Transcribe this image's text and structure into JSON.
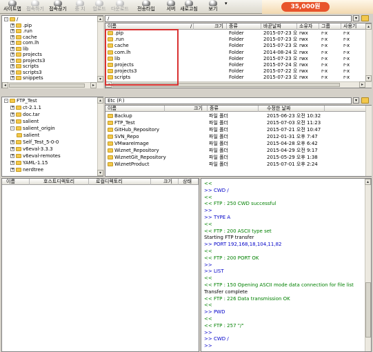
{
  "toolbar": {
    "items": [
      {
        "label": "사이트맵",
        "icon": "sitemap-icon",
        "disabled": false
      },
      {
        "label": "접속하기",
        "icon": "connect-icon",
        "disabled": true
      },
      {
        "label": "접속끊기",
        "icon": "disconnect-icon",
        "disabled": false
      },
      {
        "label": "중 지",
        "icon": "stop-icon",
        "disabled": true
      },
      {
        "label": "업로드",
        "icon": "upload-icon",
        "disabled": true
      },
      {
        "label": "다운로드",
        "icon": "download-icon",
        "disabled": true
      },
      {
        "label": "전송타입",
        "icon": "transfer-type-icon",
        "disabled": false
      },
      {
        "label": "서버",
        "icon": "server-icon",
        "disabled": false
      },
      {
        "label": "새로고침",
        "icon": "refresh-icon",
        "disabled": false
      },
      {
        "label": "보기",
        "icon": "view-icon",
        "disabled": false
      }
    ],
    "ad_price": "35,000원"
  },
  "remote": {
    "path": "/",
    "tree": [
      {
        "label": "/",
        "level": 0,
        "sign": "-"
      },
      {
        "label": ".pip",
        "level": 1,
        "sign": "+"
      },
      {
        "label": ".run",
        "level": 1,
        "sign": "+"
      },
      {
        "label": "cache",
        "level": 1,
        "sign": "+"
      },
      {
        "label": "com.lh",
        "level": 1,
        "sign": "+"
      },
      {
        "label": "lib",
        "level": 1,
        "sign": "+"
      },
      {
        "label": "projects",
        "level": 1,
        "sign": "+"
      },
      {
        "label": "projects3",
        "level": 1,
        "sign": "+"
      },
      {
        "label": "scripts",
        "level": 1,
        "sign": "+"
      },
      {
        "label": "scripts3",
        "level": 1,
        "sign": "+"
      },
      {
        "label": "snippets",
        "level": 1,
        "sign": "+"
      }
    ],
    "columns": [
      "이름",
      "/",
      "크기",
      "종류",
      "바꾼날짜",
      "소유자",
      "그룹",
      "사용기"
    ],
    "files": [
      {
        "name": ".pip",
        "type": "Folder",
        "date": "2015-07-23 오...",
        "owner": "rwx",
        "group": "r-x",
        "other": "r-x"
      },
      {
        "name": ".run",
        "type": "Folder",
        "date": "2015-07-23 오...",
        "owner": "rwx",
        "group": "r-x",
        "other": "r-x"
      },
      {
        "name": "cache",
        "type": "Folder",
        "date": "2015-07-23 오...",
        "owner": "rwx",
        "group": "r-x",
        "other": "r-x"
      },
      {
        "name": "com.lh",
        "type": "Folder",
        "date": "2014-08-24 오...",
        "owner": "rwx",
        "group": "r-x",
        "other": "r-x"
      },
      {
        "name": "lib",
        "type": "Folder",
        "date": "2015-07-23 오...",
        "owner": "rwx",
        "group": "r-x",
        "other": "r-x"
      },
      {
        "name": "projects",
        "type": "Folder",
        "date": "2015-07-24 오...",
        "owner": "rwx",
        "group": "r-x",
        "other": "r-x"
      },
      {
        "name": "projects3",
        "type": "Folder",
        "date": "2015-07-22 오...",
        "owner": "rwx",
        "group": "r-x",
        "other": "r-x"
      },
      {
        "name": "scripts",
        "type": "Folder",
        "date": "2015-07-23 오...",
        "owner": "rwx",
        "group": "r-x",
        "other": "r-x"
      }
    ]
  },
  "local": {
    "path": "Etc (F:)",
    "tree": [
      {
        "label": "FTP_Test",
        "level": 0,
        "sign": "-"
      },
      {
        "label": "ct-2.1.1",
        "level": 1,
        "sign": "+"
      },
      {
        "label": "doc.tar",
        "level": 1,
        "sign": "+"
      },
      {
        "label": "salient",
        "level": 1,
        "sign": "+"
      },
      {
        "label": "salient_origin",
        "level": 1,
        "sign": "-"
      },
      {
        "label": "salient",
        "level": 2,
        "sign": ""
      },
      {
        "label": "Self_Test_5-0-0",
        "level": 1,
        "sign": "+"
      },
      {
        "label": "v6eval-3.3.3",
        "level": 1,
        "sign": "+"
      },
      {
        "label": "v6eval-remotes",
        "level": 1,
        "sign": "+"
      },
      {
        "label": "YAML-1.15",
        "level": 1,
        "sign": "+"
      },
      {
        "label": "nerdtree",
        "level": 1,
        "sign": "+"
      }
    ],
    "columns": [
      "이름",
      "크기",
      "종류",
      "수정한 날짜"
    ],
    "files": [
      {
        "name": "Backup",
        "type": "파일 폴더",
        "date": "2015-06-23 오전 10:32"
      },
      {
        "name": "FTP_Test",
        "type": "파일 폴더",
        "date": "2015-07-03 오전 11:23"
      },
      {
        "name": "GitHub_Repository",
        "type": "파일 폴더",
        "date": "2015-07-21 오전 10:47"
      },
      {
        "name": "SVN_Repo",
        "type": "파일 폴더",
        "date": "2012-01-31 오후 7:47"
      },
      {
        "name": "VMwareImage",
        "type": "파일 폴더",
        "date": "2015-04-28 오후 6:42"
      },
      {
        "name": "Wiznet_Repository",
        "type": "파일 폴더",
        "date": "2015-04-29 오전 9:17"
      },
      {
        "name": "WiznetGit_Repository",
        "type": "파일 폴더",
        "date": "2015-05-29 오후 1:38"
      },
      {
        "name": "WiznetProduct",
        "type": "파일 폴더",
        "date": "2015-07-01 오후 2:24"
      }
    ]
  },
  "queue": {
    "columns": [
      "이름",
      "호스트디렉토리",
      "로컬디렉토리",
      "크기",
      "상태"
    ]
  },
  "log": [
    {
      "text": "<<",
      "kind": "srv"
    },
    {
      "text": ">> CWD /",
      "kind": "cli"
    },
    {
      "text": "<<",
      "kind": "srv"
    },
    {
      "text": "<< FTP : 250 CWD successful",
      "kind": "srv"
    },
    {
      "text": ">>",
      "kind": "cli"
    },
    {
      "text": ">> TYPE A",
      "kind": "cli"
    },
    {
      "text": "<<",
      "kind": "srv"
    },
    {
      "text": "<< FTP : 200 ASCII type set",
      "kind": "srv"
    },
    {
      "text": "Starting FTP transfer",
      "kind": "info"
    },
    {
      "text": ">> PORT 192,168,18,104,11,82",
      "kind": "cli"
    },
    {
      "text": "<<",
      "kind": "srv"
    },
    {
      "text": "<< FTP : 200 PORT OK",
      "kind": "srv"
    },
    {
      "text": ">>",
      "kind": "cli"
    },
    {
      "text": ">> LIST",
      "kind": "cli"
    },
    {
      "text": "<<",
      "kind": "srv"
    },
    {
      "text": "<< FTP : 150 Opening ASCII mode data connection for file list",
      "kind": "srv"
    },
    {
      "text": "Transfer complete",
      "kind": "info"
    },
    {
      "text": "<< FTP : 226 Data transmission OK",
      "kind": "srv"
    },
    {
      "text": "<<",
      "kind": "srv"
    },
    {
      "text": ">> PWD",
      "kind": "cli"
    },
    {
      "text": "<<",
      "kind": "srv"
    },
    {
      "text": "<< FTP : 257 \"/\"",
      "kind": "srv"
    },
    {
      "text": ">>",
      "kind": "cli"
    },
    {
      "text": ">> CWD /",
      "kind": "cli"
    },
    {
      "text": ">>",
      "kind": "cli"
    }
  ]
}
